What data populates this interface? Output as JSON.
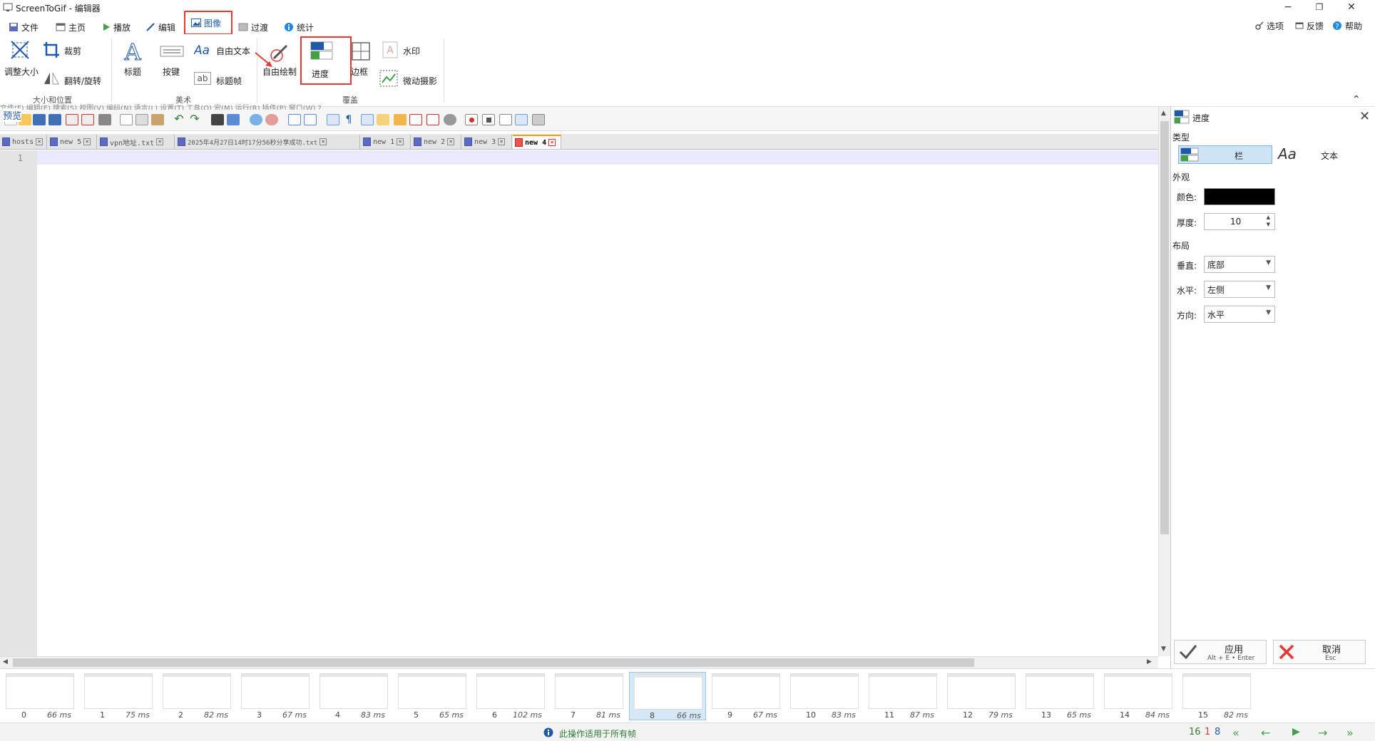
{
  "window": {
    "title": "ScreenToGif - 编辑器",
    "minimize": "−",
    "restore": "❐",
    "close": "✕"
  },
  "menu_tabs": [
    {
      "label": "文件",
      "icon": "save-icon"
    },
    {
      "label": "主页",
      "icon": "home-icon"
    },
    {
      "label": "播放",
      "icon": "play-icon"
    },
    {
      "label": "编辑",
      "icon": "pencil-icon"
    },
    {
      "label": "图像",
      "icon": "image-icon"
    },
    {
      "label": "过渡",
      "icon": "transition-icon"
    },
    {
      "label": "统计",
      "icon": "info-icon"
    }
  ],
  "top_right": {
    "options": "选项",
    "feedback": "反馈",
    "help": "帮助"
  },
  "ribbon": {
    "resize": "调整大小",
    "crop": "裁剪",
    "flip_rotate": "翻转/旋转",
    "group_size": "大小和位置",
    "title": "标题",
    "keys": "按键",
    "free_text": "自由文本",
    "title_frame": "标题帧",
    "group_art": "美术",
    "free_draw": "自由绘制",
    "progress": "进度",
    "border": "边框",
    "watermark": "水印",
    "cinemagraph": "微动摄影",
    "group_overlay": "覆盖"
  },
  "preview_label": "预览",
  "notepad": {
    "menu": "文件(F)  编辑(E)  搜索(S)  视图(V)  编码(N)  语言(L)  设置(T)  工具(O)  宏(M)  运行(R)  插件(P)  窗口(W)  ?",
    "tabs": [
      {
        "name": "hosts",
        "icon": "file-icon"
      },
      {
        "name": "new 5",
        "icon": "file-icon"
      },
      {
        "name": "vpn地址.txt",
        "icon": "file-icon"
      },
      {
        "name": "2025年4月27日14时17分56秒分享成功.txt",
        "icon": "file-icon"
      },
      {
        "name": "new 1",
        "icon": "file-icon"
      },
      {
        "name": "new 2",
        "icon": "file-icon"
      },
      {
        "name": "new 3",
        "icon": "file-icon"
      },
      {
        "name": "new 4",
        "icon": "file-red-icon"
      }
    ],
    "line_number": "1"
  },
  "panel": {
    "title": "进度",
    "type_label": "类型",
    "type_bar": "栏",
    "type_text_glyph": "Aa",
    "type_text": "文本",
    "appearance": "外观",
    "color_label": "颜色:",
    "color_value": "#000000",
    "thickness_label": "厚度:",
    "thickness_value": "10",
    "layout": "布局",
    "vertical_label": "垂直:",
    "vertical_value": "底部",
    "horizontal_label": "水平:",
    "horizontal_value": "左侧",
    "direction_label": "方向:",
    "direction_value": "水平",
    "apply": "应用",
    "apply_hint": "Alt + E • Enter",
    "cancel": "取消",
    "cancel_hint": "Esc"
  },
  "frames": [
    {
      "n": "0",
      "ms": "66 ms"
    },
    {
      "n": "1",
      "ms": "75 ms"
    },
    {
      "n": "2",
      "ms": "82 ms"
    },
    {
      "n": "3",
      "ms": "67 ms"
    },
    {
      "n": "4",
      "ms": "83 ms"
    },
    {
      "n": "5",
      "ms": "65 ms"
    },
    {
      "n": "6",
      "ms": "102 ms"
    },
    {
      "n": "7",
      "ms": "81 ms"
    },
    {
      "n": "8",
      "ms": "66 ms"
    },
    {
      "n": "9",
      "ms": "67 ms"
    },
    {
      "n": "10",
      "ms": "83 ms"
    },
    {
      "n": "11",
      "ms": "87 ms"
    },
    {
      "n": "12",
      "ms": "79 ms"
    },
    {
      "n": "13",
      "ms": "65 ms"
    },
    {
      "n": "14",
      "ms": "84 ms"
    },
    {
      "n": "15",
      "ms": "82 ms"
    }
  ],
  "selected_frame": 8,
  "status": {
    "message": "此操作适用于所有帧",
    "total": "16",
    "selected_count": "1",
    "current": "8"
  },
  "colors": {
    "accent_red": "#e53935",
    "selection_blue": "#cfe3f7",
    "status_green": "#2e7d32",
    "nav_green": "#43a047"
  }
}
